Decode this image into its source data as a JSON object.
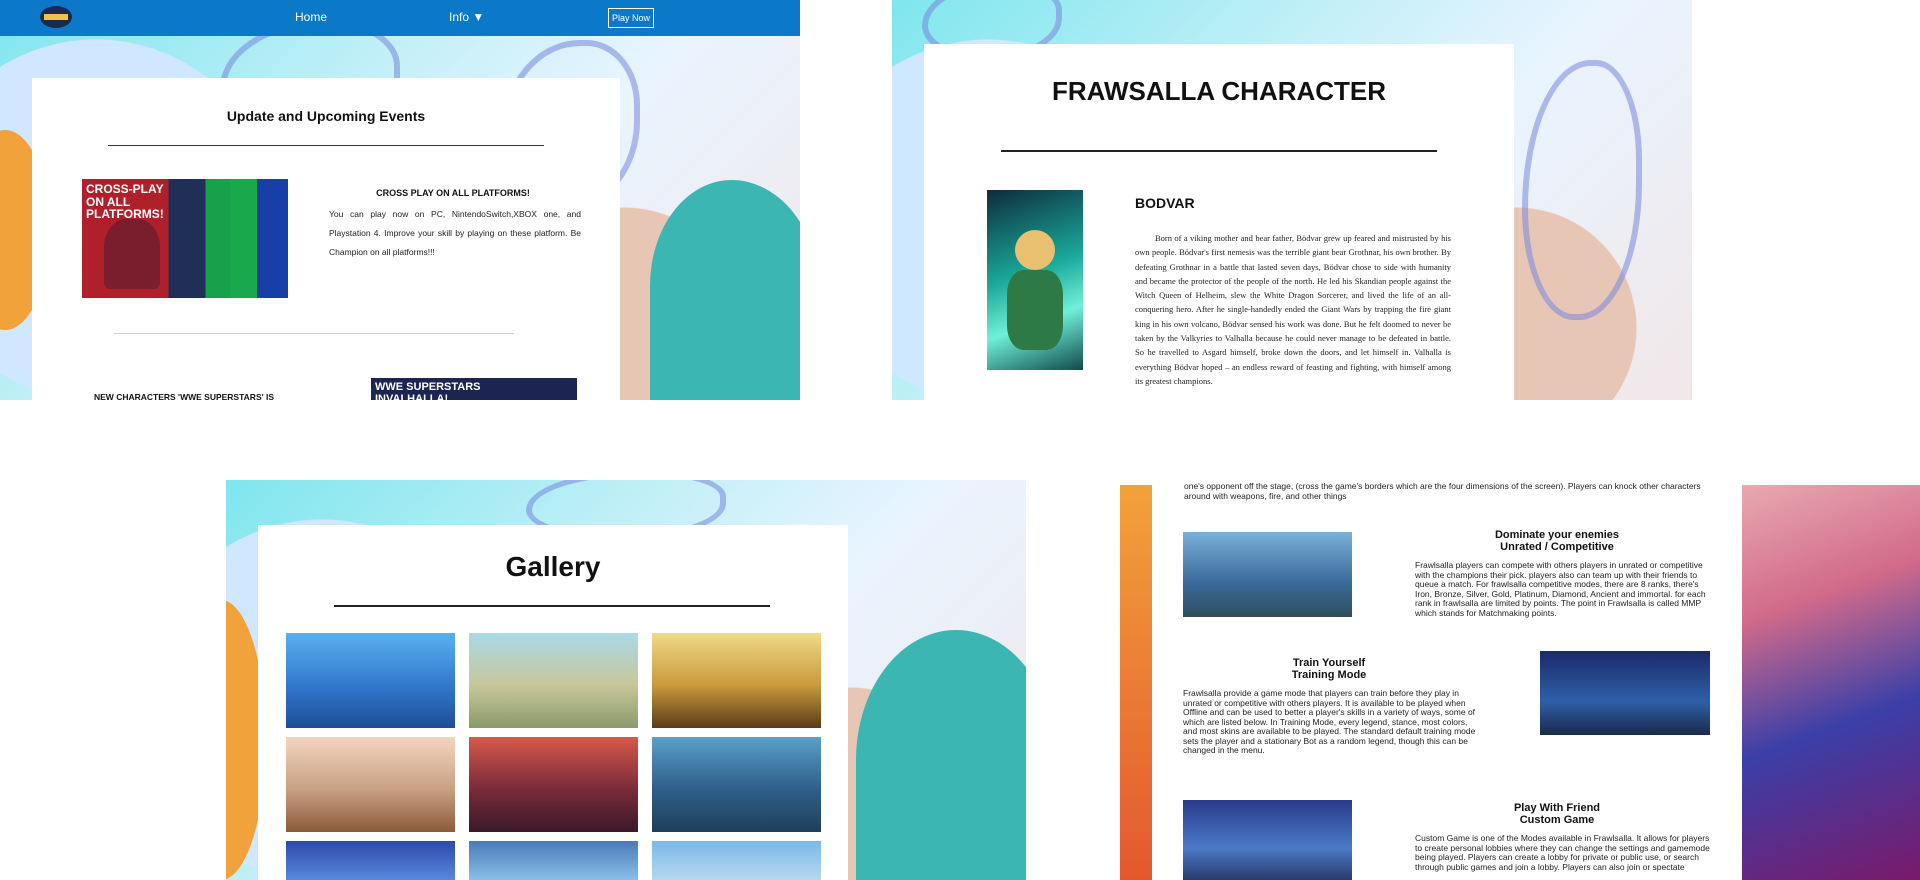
{
  "panel1": {
    "nav": {
      "home": "Home",
      "info": "Info ▼",
      "play_now": "Play Now"
    },
    "section_title": "Update and Upcoming Events",
    "event1": {
      "image_title": "CROSS-PLAY\nON ALL PLATFORMS!",
      "heading": "CROSS PLAY ON ALL PLATFORMS!",
      "body": "You can play now on PC, NintendoSwitch,XBOX one, and Playstation 4. Improve your skill by playing on these platform. Be Champion on all platforms!!!"
    },
    "event2": {
      "heading": "NEW CHARACTERS 'WWE SUPERSTARS' IS",
      "image_title": "WWE SUPERSTARS\nINVALHALLA!"
    }
  },
  "panel2": {
    "page_title": "FRAWSALLA CHARACTER",
    "character_name": "BODVAR",
    "character_bio": "Born of a viking mother and bear father, Bödvar grew up feared and mistrusted by his own people. Bödvar's first nemesis was the terrible giant bear Grothnar, his own brother. By defeating Grothnar in a battle that lasted seven days, Bödvar chose to side with humanity and became the protector of the people of the north. He led his Skandian people against the Witch Queen of Helheim, slew the White Dragon Sorcerer, and lived the life of an all-conquering hero. After he single-handedly ended the Giant Wars by trapping the fire giant king in his own volcano, Bödvar sensed his work was done. But he felt doomed to never be taken by the Valkyries to Valhalla because he could never manage to be defeated in battle. So he travelled to Asgard himself, broke down the doors, and let himself in. Valhalla is everything Bödvar hoped – an endless reward of feasting and fighting, with himself among its greatest champions."
  },
  "panel3": {
    "page_title": "Gallery"
  },
  "panel4": {
    "intro_tail": "one's opponent off the stage, (cross the game's borders which are the four dimensions of the screen). Players can knock other characters around with weapons, fire, and other things",
    "modes": [
      {
        "title": "Dominate your enemies",
        "subtitle": "Unrated / Competitive",
        "body": "Frawlsalla players can compete with others players in unrated or competitive with the champions their pick. players also can team up with their friends to queue a match. For frawlsalla competitive modes, there are 8 ranks, there's Iron, Bronze, Silver, Gold, Platinum, Diamond, Ancient and immortal. for each rank in frawlsalla are limited by points. The point in Frawlsalla is called MMP which stands for Matchmaking points."
      },
      {
        "title": "Train Yourself",
        "subtitle": "Training Mode",
        "body": "Frawlsalla provide a game mode that players can train before they play in unrated or competitive with others players. It is available to be played when Offline and can be used to better a player's skills in a variety of ways, some of which are listed below. In Training Mode, every legend, stance, most colors, and most skins are available to be played. The standard default training mode sets the player and a stationary Bot as a random legend, though this can be changed in the menu."
      },
      {
        "title": "Play With Friend",
        "subtitle": "Custom Game",
        "body": "Custom Game is one of the Modes available in Frawlsalla. It allows for players to create personal lobbies where they can change the settings and gamemode being played. Players can create a lobby for private or public use, or search through public games and join a lobby. Players can also join or spectate"
      }
    ]
  },
  "colors": {
    "nav_blue": "#0b78c8",
    "card_white": "#ffffff",
    "divider": "#222222"
  }
}
